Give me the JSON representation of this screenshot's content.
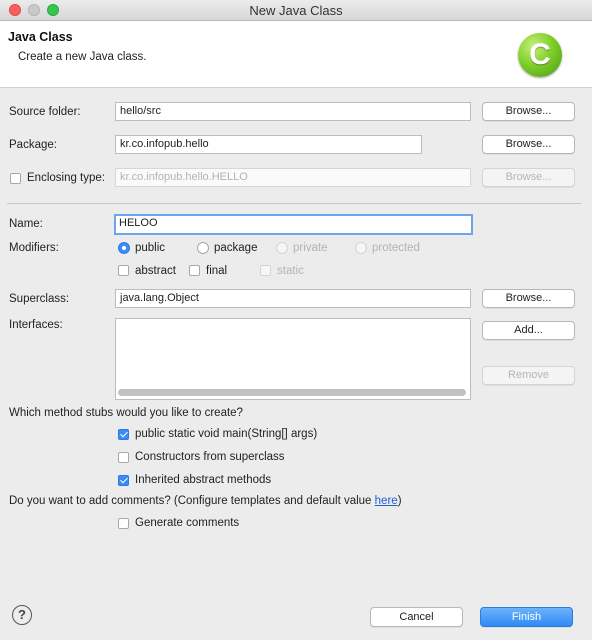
{
  "window": {
    "title": "New Java Class"
  },
  "header": {
    "title": "Java Class",
    "subtitle": "Create a new Java class.",
    "logo_letter": "C"
  },
  "source_folder": {
    "label": "Source folder:",
    "value": "hello/src",
    "browse": "Browse..."
  },
  "package": {
    "label": "Package:",
    "value": "kr.co.infopub.hello",
    "browse": "Browse..."
  },
  "enclosing": {
    "label": "Enclosing type:",
    "value": "kr.co.infopub.hello.HELLO",
    "browse": "Browse..."
  },
  "name": {
    "label": "Name:",
    "value": "HELOO"
  },
  "modifiers": {
    "label": "Modifiers:",
    "public": "public",
    "package": "package",
    "private": "private",
    "protected": "protected",
    "abstract": "abstract",
    "final": "final",
    "static": "static"
  },
  "superclass": {
    "label": "Superclass:",
    "value": "java.lang.Object",
    "browse": "Browse..."
  },
  "interfaces": {
    "label": "Interfaces:",
    "add": "Add...",
    "remove": "Remove"
  },
  "stubs": {
    "question": "Which method stubs would you like to create?",
    "main": "public static void main(String[] args)",
    "constructors": "Constructors from superclass",
    "inherited": "Inherited abstract methods"
  },
  "comments": {
    "question": "Do you want to add comments? (Configure templates and default value ",
    "link": "here",
    "question_end": ")",
    "generate": "Generate comments"
  },
  "footer": {
    "help": "?",
    "cancel": "Cancel",
    "finish": "Finish"
  }
}
